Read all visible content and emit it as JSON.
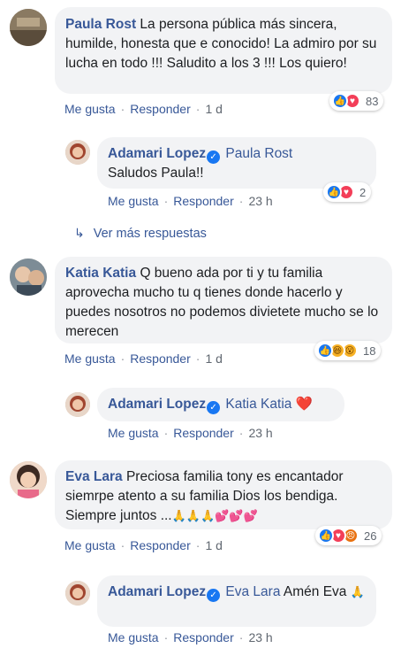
{
  "comments": [
    {
      "author": "Paula Rost",
      "text": "La persona pública más sincera, humilde, honesta que e conocido! La admiro por su lucha en todo !!! Saludito a los 3 !!! Los quiero!",
      "actions": {
        "like": "Me gusta",
        "reply": "Responder",
        "time": "1 d"
      },
      "reaction_count": "83",
      "reactions": [
        "like-icon",
        "love-icon"
      ]
    },
    {
      "author": "Adamari Lopez",
      "verified": true,
      "tag": "Paula Rost",
      "text": "Saludos Paula!!",
      "actions": {
        "like": "Me gusta",
        "reply": "Responder",
        "time": "23 h"
      },
      "reaction_count": "2",
      "reactions": [
        "like-icon",
        "love-icon"
      ]
    },
    {
      "more_replies": "Ver más respuestas"
    },
    {
      "author": "Katia Katia",
      "text": "Q bueno ada por ti y tu familia aprovecha mucho tu q tienes donde hacerlo y puedes nosotros no podemos divietete mucho se lo merecen",
      "actions": {
        "like": "Me gusta",
        "reply": "Responder",
        "time": "1 d"
      },
      "reaction_count": "18",
      "reactions": [
        "like-icon",
        "haha-icon",
        "wow-icon"
      ]
    },
    {
      "author": "Adamari Lopez",
      "verified": true,
      "tag": "Katia Katia",
      "text": "",
      "emoji": "❤️",
      "actions": {
        "like": "Me gusta",
        "reply": "Responder",
        "time": "23 h"
      }
    },
    {
      "author": "Eva Lara",
      "text": "Preciosa familia tony es encantador siemrpe atento a su familia Dios los bendiga. Siempre juntos ...",
      "emoji": "🙏🙏🙏💕💕💕",
      "actions": {
        "like": "Me gusta",
        "reply": "Responder",
        "time": "1 d"
      },
      "reaction_count": "26",
      "reactions": [
        "like-icon",
        "love-icon",
        "angry-icon"
      ]
    },
    {
      "author": "Adamari Lopez",
      "verified": true,
      "tag": "Eva Lara",
      "text": "Amén Eva",
      "emoji": "🙏",
      "actions": {
        "like": "Me gusta",
        "reply": "Responder",
        "time": "23 h"
      }
    }
  ],
  "colors": {
    "link": "#385898",
    "bubble": "#f2f3f5",
    "meta": "#606770",
    "like": "#1877f2",
    "love": "#f33e58"
  }
}
